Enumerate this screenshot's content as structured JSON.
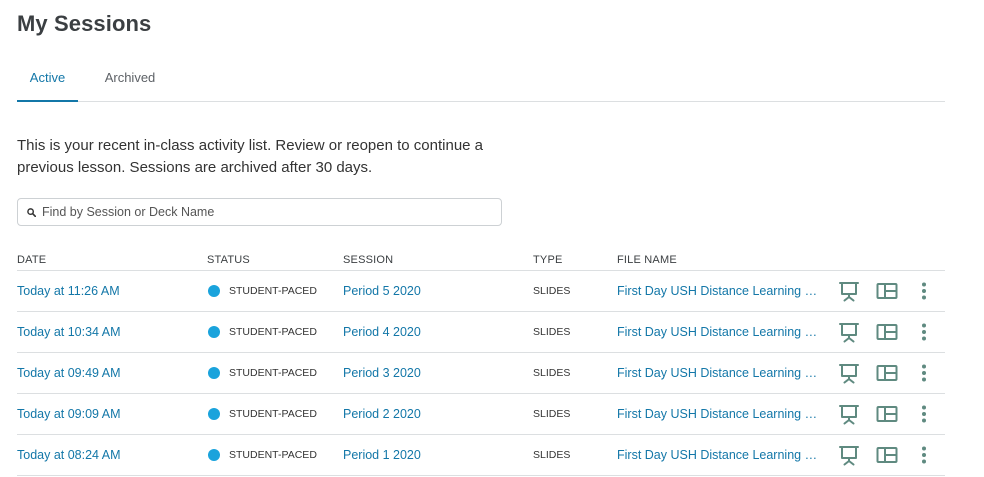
{
  "page": {
    "title": "My Sessions"
  },
  "tabs": [
    {
      "label": "Active",
      "active": true
    },
    {
      "label": "Archived",
      "active": false
    }
  ],
  "intro": "This is your recent in-class activity list. Review or reopen to continue a previous lesson. Sessions are archived after 30 days.",
  "search": {
    "placeholder": "Find by Session or Deck Name",
    "value": "",
    "icon": "search-icon"
  },
  "table": {
    "columns": [
      "DATE",
      "STATUS",
      "SESSION",
      "TYPE",
      "FILE NAME"
    ],
    "rows": [
      {
        "date": "Today at 11:26 AM",
        "status": "STUDENT-PACED",
        "session": "Period 5 2020",
        "type": "SLIDES",
        "file": "First Day USH Distance Learning Lesson"
      },
      {
        "date": "Today at 10:34 AM",
        "status": "STUDENT-PACED",
        "session": "Period 4 2020",
        "type": "SLIDES",
        "file": "First Day USH Distance Learning Lesson"
      },
      {
        "date": "Today at 09:49 AM",
        "status": "STUDENT-PACED",
        "session": "Period 3 2020",
        "type": "SLIDES",
        "file": "First Day USH Distance Learning Lesson"
      },
      {
        "date": "Today at 09:09 AM",
        "status": "STUDENT-PACED",
        "session": "Period 2 2020",
        "type": "SLIDES",
        "file": "First Day USH Distance Learning Lesson"
      },
      {
        "date": "Today at 08:24 AM",
        "status": "STUDENT-PACED",
        "session": "Period 1 2020",
        "type": "SLIDES",
        "file": "First Day USH Distance Learning Lesson"
      }
    ],
    "row_icons": [
      "presentation-board-icon",
      "session-viewer-icon",
      "more-options-icon"
    ]
  },
  "colors": {
    "accent": "#1377a8",
    "status_dot": "#1aa3dc",
    "icon": "#5f8a80",
    "divider": "#dcdfe1"
  }
}
